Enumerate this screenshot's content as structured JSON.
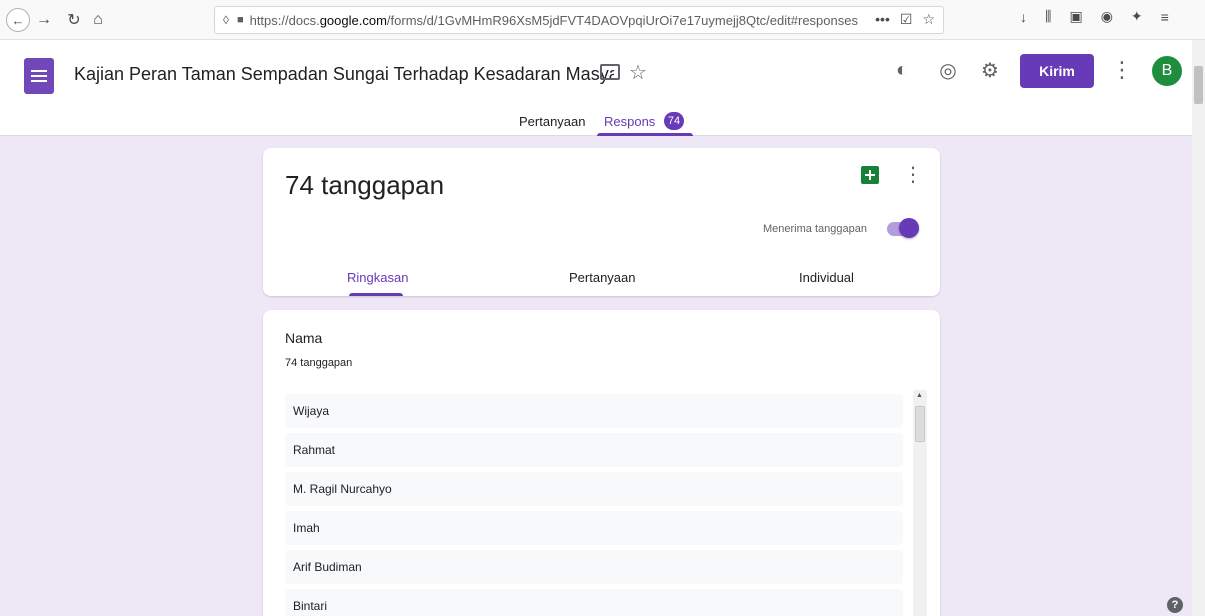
{
  "browser": {
    "url_prefix": "https://docs.",
    "url_domain": "google.com",
    "url_path": "/forms/d/1GvMHmR96XsM5jdFVT4DAOVpqiUrOi7e17uymejj8Qtc/edit#responses"
  },
  "header": {
    "form_title": "Kajian Peran Taman Sempadan Sungai Terhadap Kesadaran Masyarakat Te",
    "send_label": "Kirim",
    "avatar_initial": "B"
  },
  "tabs": {
    "questions": "Pertanyaan",
    "responses": "Respons",
    "responses_badge": "74"
  },
  "summary": {
    "count_title": "74 tanggapan",
    "accepting_label": "Menerima tanggapan",
    "accepting": true,
    "subtabs": [
      "Ringkasan",
      "Pertanyaan",
      "Individual"
    ]
  },
  "question": {
    "title": "Nama",
    "count": "74 tanggapan",
    "answers": [
      "Wijaya",
      "Rahmat",
      "M. Ragil Nurcahyo",
      "Imah",
      "Arif Budiman",
      "Bintari"
    ]
  },
  "colors": {
    "accent": "#673ab7",
    "background": "#ede7f6",
    "sheets": "#188038",
    "avatar": "#1e8e3e"
  }
}
